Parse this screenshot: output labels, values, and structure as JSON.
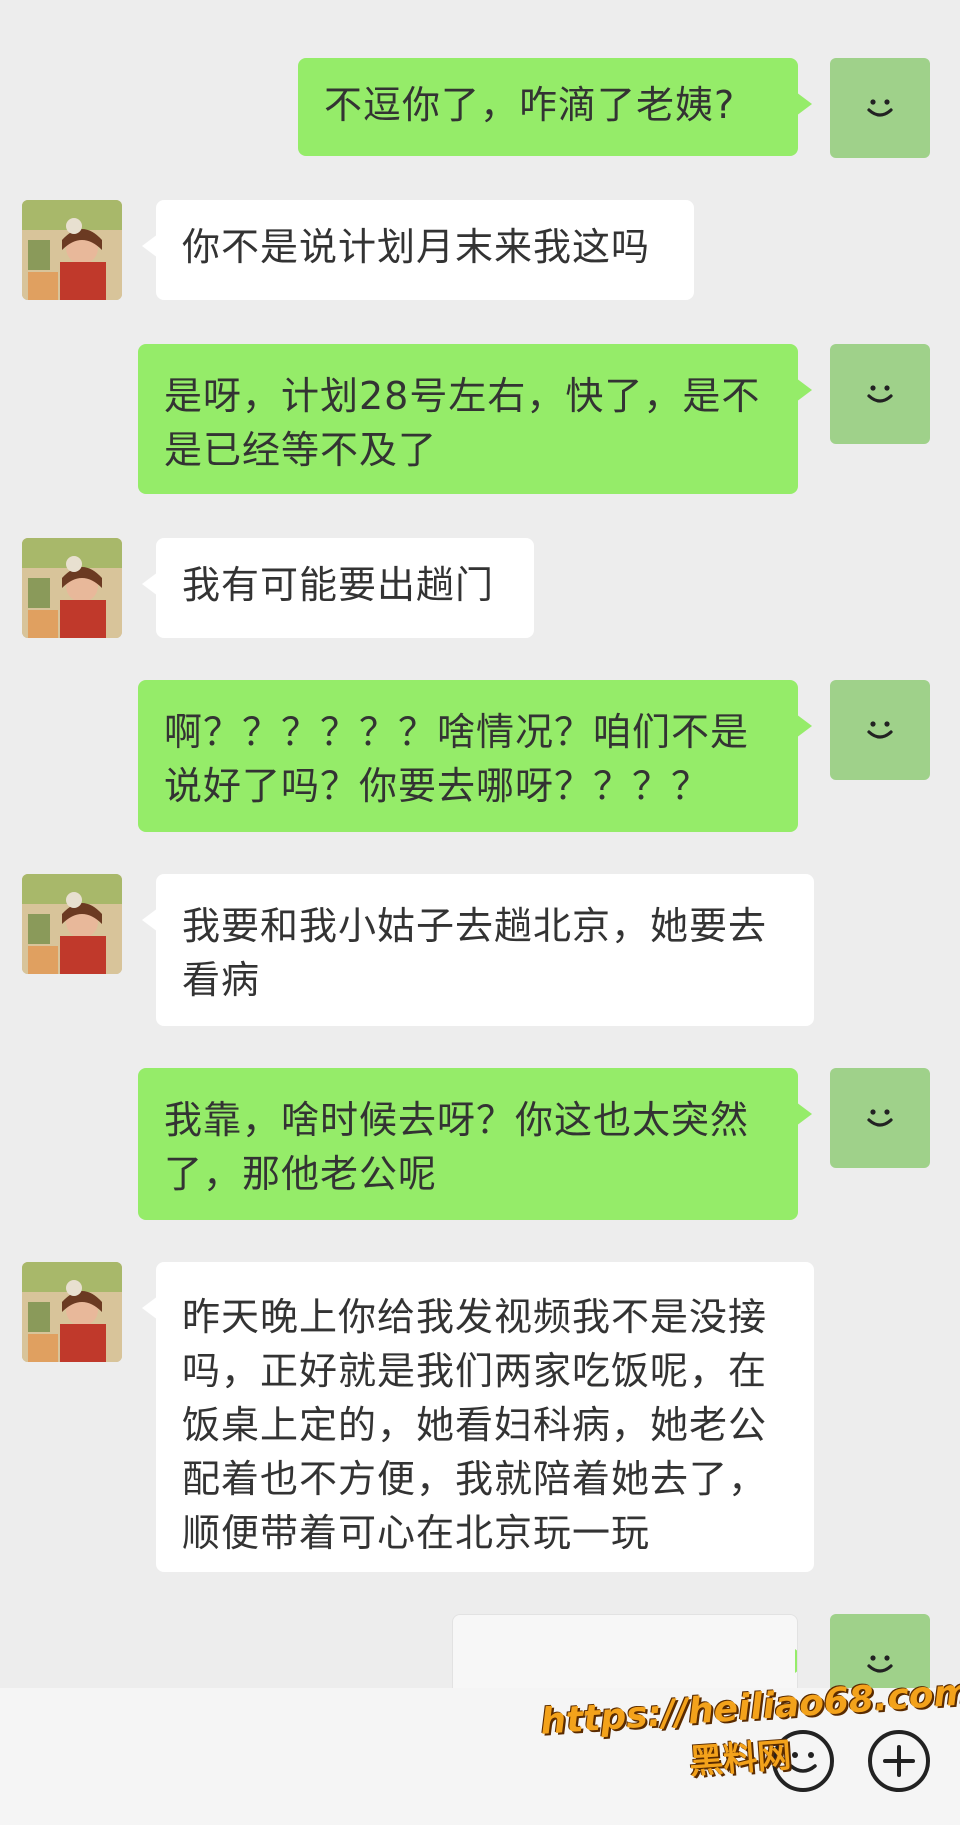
{
  "messages": [
    {
      "from": "self",
      "text": "不逗你了，咋滴了老姨?"
    },
    {
      "from": "other",
      "text": "你不是说计划月末来我这吗"
    },
    {
      "from": "self",
      "text": "是呀，计划28号左右，快了，是不是已经等不及了"
    },
    {
      "from": "other",
      "text": "我有可能要出趟门"
    },
    {
      "from": "self",
      "text": "啊？？？？？？啥情况？咱们不是说好了吗？你要去哪呀？？？？"
    },
    {
      "from": "other",
      "text": "我要和我小姑子去趟北京，她要去看病"
    },
    {
      "from": "self",
      "text": "我靠，啥时候去呀？你这也太突然了，那他老公呢"
    },
    {
      "from": "other",
      "text": "昨天晚上你给我发视频我不是没接吗，正好就是我们两家吃饭呢，在饭桌上定的，她看妇科病，她老公配着也不方便，我就陪着她去了，顺便带着可心在北京玩一玩"
    }
  ],
  "watermark": {
    "url": "https://heiliao68.com",
    "site": "黑料网"
  },
  "icons": {
    "self_avatar": "smiley-avatar-icon",
    "emoji_button": "emoji-icon",
    "more_button": "plus-circle-icon"
  },
  "colors": {
    "self_bubble": "#95ec69",
    "other_bubble": "#ffffff",
    "background": "#ededed"
  }
}
